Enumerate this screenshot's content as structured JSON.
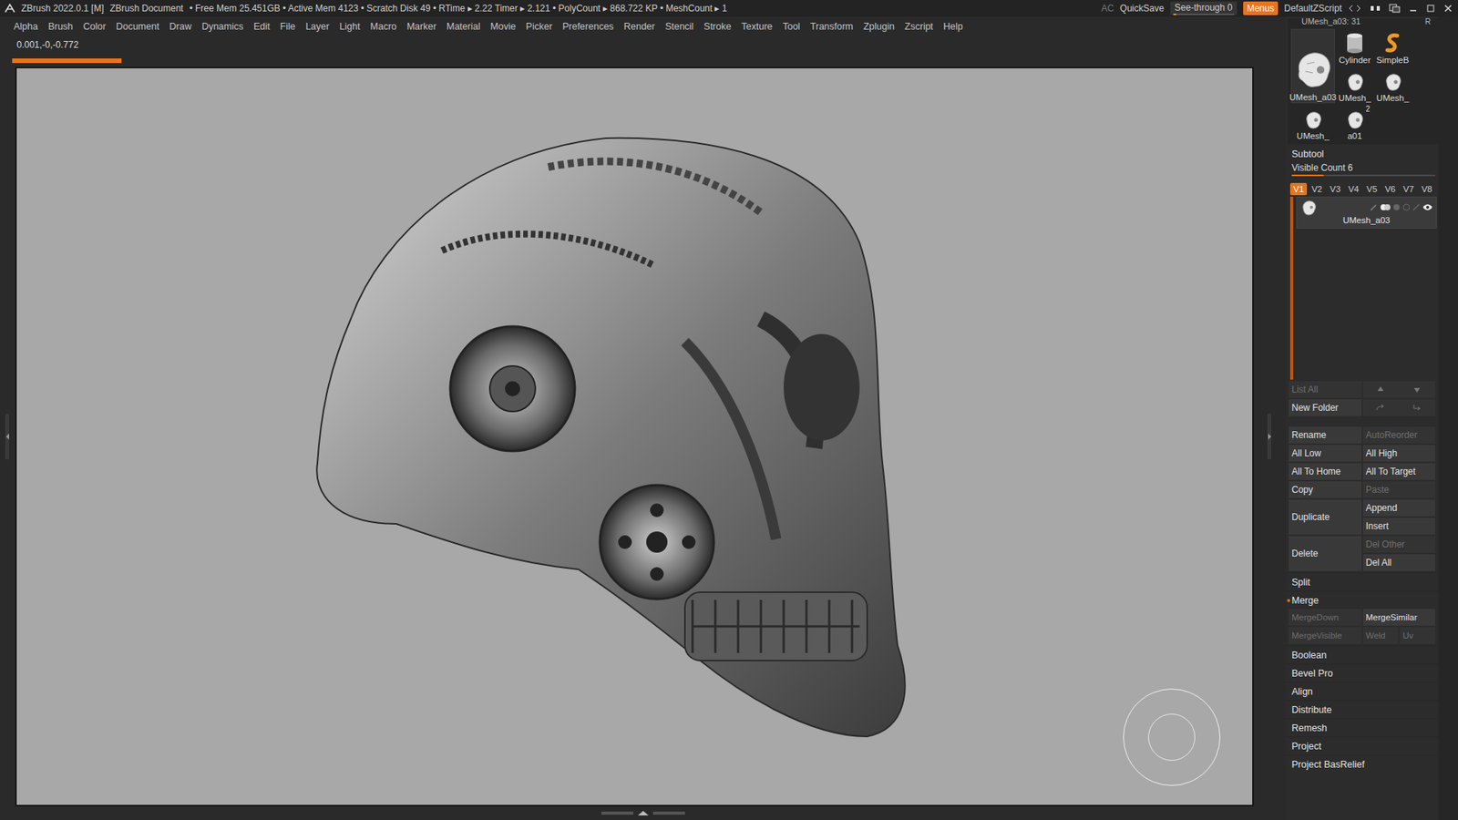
{
  "title_bar": {
    "app": "ZBrush 2022.0.1 [M]",
    "document": "ZBrush Document",
    "stats": "• Free Mem 25.451GB • Active Mem 4123 • Scratch Disk 49 • RTime ▸ 2.22 Timer ▸ 2.121 • PolyCount ▸ 868.722 KP • MeshCount ▸ 1",
    "ac": "AC",
    "quicksave": "QuickSave",
    "see_through": {
      "label": "See-through",
      "value": "0",
      "level": 0.05
    },
    "menus": {
      "label": "Menus",
      "on": true
    },
    "script": "DefaultZScript"
  },
  "menu": [
    "Alpha",
    "Brush",
    "Color",
    "Document",
    "Draw",
    "Dynamics",
    "Edit",
    "File",
    "Layer",
    "Light",
    "Macro",
    "Marker",
    "Material",
    "Movie",
    "Picker",
    "Preferences",
    "Render",
    "Stencil",
    "Stroke",
    "Texture",
    "Tool",
    "Transform",
    "Zplugin",
    "Zscript",
    "Help"
  ],
  "info": {
    "coords": "0.001,-0,-0.772",
    "progress": {
      "level": 0.09
    }
  },
  "tool_palette": {
    "header": "UMesh_a03: 31",
    "r": "R",
    "items": [
      {
        "label": "UMesh_a03",
        "kind": "large",
        "selected": true
      },
      {
        "label": "Cylinder",
        "kind": "cylinder",
        "selected": false
      },
      {
        "label": "SimpleB",
        "kind": "brush",
        "selected": false
      },
      {
        "label": "UMesh_",
        "kind": "small",
        "selected": false
      },
      {
        "label": "UMesh_",
        "kind": "small",
        "selected": false
      },
      {
        "label": "UMesh_",
        "kind": "small",
        "selected": false
      },
      {
        "label": "a01",
        "kind": "small",
        "selected": false,
        "badge": "2"
      }
    ]
  },
  "subtool": {
    "title": "Subtool",
    "visible_count": {
      "label": "Visible Count 6",
      "level": 0.22
    },
    "pages": [
      {
        "label": "V1",
        "selected": true
      },
      {
        "label": "V2",
        "selected": false
      },
      {
        "label": "V3",
        "selected": false
      },
      {
        "label": "V4",
        "selected": false
      },
      {
        "label": "V5",
        "selected": false
      },
      {
        "label": "V6",
        "selected": false
      },
      {
        "label": "V7",
        "selected": false
      },
      {
        "label": "V8",
        "selected": false
      }
    ],
    "items": [
      {
        "name": "UMesh_a03",
        "selected": true,
        "visible": true
      }
    ],
    "list_slider": {
      "level": 1.0
    },
    "list_all": {
      "label": "List All",
      "disabled": true
    },
    "new_folder": {
      "label": "New Folder",
      "disabled": false
    },
    "actions": [
      {
        "label": "Rename",
        "disabled": false,
        "kind": "normal"
      },
      {
        "label": "AutoReorder",
        "disabled": true,
        "kind": "normal"
      },
      {
        "label": "All Low",
        "disabled": false,
        "kind": "normal"
      },
      {
        "label": "All High",
        "disabled": false,
        "kind": "normal"
      },
      {
        "label": "All To Home",
        "disabled": false,
        "kind": "normal"
      },
      {
        "label": "All To Target",
        "disabled": false,
        "kind": "normal"
      },
      {
        "label": "Copy",
        "disabled": false,
        "kind": "normal"
      },
      {
        "label": "Paste",
        "disabled": true,
        "kind": "normal"
      },
      {
        "label": "Duplicate",
        "disabled": false,
        "kind": "tall"
      },
      {
        "label": "Append",
        "disabled": false,
        "kind": "normal"
      },
      {
        "label": "Insert",
        "disabled": false,
        "kind": "normal"
      },
      {
        "label": "Delete",
        "disabled": false,
        "kind": "tall"
      },
      {
        "label": "Del Other",
        "disabled": true,
        "kind": "normal"
      },
      {
        "label": "Del All",
        "disabled": false,
        "kind": "normal"
      }
    ]
  },
  "sections": [
    {
      "label": "Split",
      "expanded": false,
      "buttons": []
    },
    {
      "label": "Merge",
      "expanded": true,
      "buttons": [
        {
          "label": "MergeDown",
          "disabled": true,
          "kind": "wide"
        },
        {
          "label": "MergeSimilar",
          "disabled": false,
          "kind": "wide"
        },
        {
          "label": "MergeVisible",
          "disabled": true,
          "kind": "wide"
        },
        {
          "label": "Weld",
          "disabled": true,
          "kind": "narrow"
        },
        {
          "label": "Uv",
          "disabled": true,
          "kind": "narrow"
        }
      ]
    },
    {
      "label": "Boolean",
      "expanded": false,
      "buttons": []
    },
    {
      "label": "Bevel Pro",
      "expanded": false,
      "buttons": []
    },
    {
      "label": "Align",
      "expanded": false,
      "buttons": []
    },
    {
      "label": "Distribute",
      "expanded": false,
      "buttons": []
    },
    {
      "label": "Remesh",
      "expanded": false,
      "buttons": []
    },
    {
      "label": "Project",
      "expanded": false,
      "buttons": []
    },
    {
      "label": "Project BasRelief",
      "expanded": false,
      "buttons": []
    }
  ]
}
